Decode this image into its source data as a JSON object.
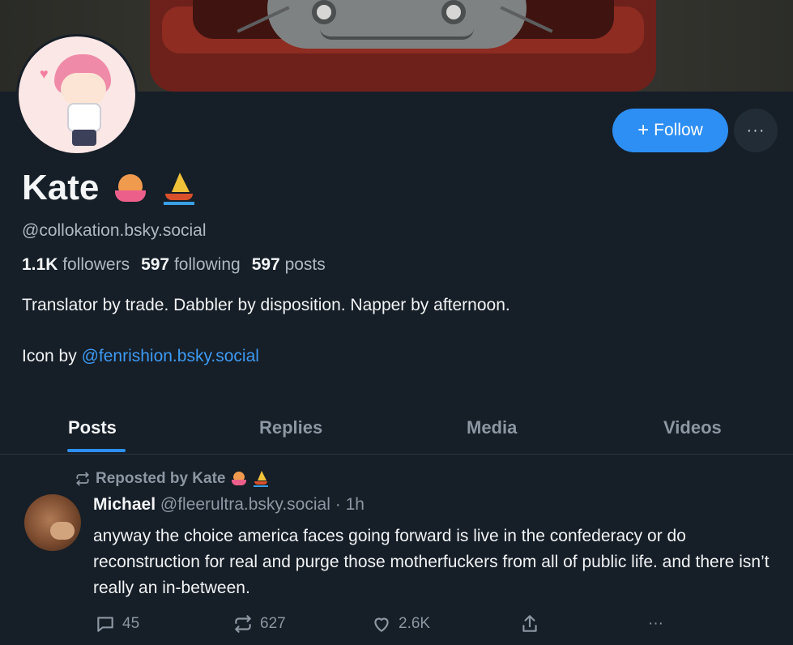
{
  "profile": {
    "display_name": "Kate",
    "handle": "@collokation.bsky.social",
    "stats": {
      "followers_count": "1.1K",
      "followers_label": "followers",
      "following_count": "597",
      "following_label": "following",
      "posts_count": "597",
      "posts_label": "posts"
    },
    "bio": "Translator by trade. Dabbler by disposition. Napper by afternoon.",
    "icon_credit_prefix": "Icon by",
    "icon_credit_link": "@fenrishion.bsky.social",
    "name_emojis": [
      "octopus",
      "sailboat"
    ]
  },
  "buttons": {
    "follow_label": "Follow",
    "follow_plus": "+",
    "more_label": "···"
  },
  "tabs": [
    {
      "label": "Posts",
      "active": true
    },
    {
      "label": "Replies",
      "active": false
    },
    {
      "label": "Media",
      "active": false
    },
    {
      "label": "Videos",
      "active": false
    }
  ],
  "post": {
    "repost_label": "Reposted by Kate",
    "author": "Michael",
    "author_handle": "@fleerultra.bsky.social",
    "separator": "·",
    "time": "1h",
    "text": "anyway the choice america faces going forward is live in the confederacy or do reconstruction for real and purge those motherfuckers from all of public life. and there isn’t really an in-between.",
    "replies": "45",
    "reposts": "627",
    "likes": "2.6K",
    "more": "···"
  },
  "colors": {
    "background": "#161e27",
    "accent": "#2d8ef3",
    "link": "#3d9af3",
    "muted": "#8c97a3"
  }
}
